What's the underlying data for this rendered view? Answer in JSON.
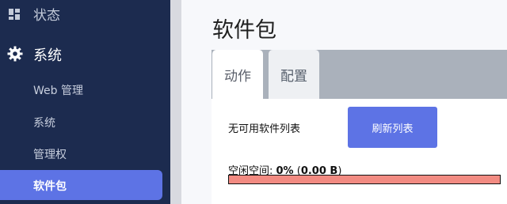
{
  "sidebar": {
    "status_label": "状态",
    "system_label": "系统",
    "items": [
      {
        "label": "Web 管理"
      },
      {
        "label": "系统"
      },
      {
        "label": "管理权"
      },
      {
        "label": "软件包"
      }
    ]
  },
  "main": {
    "title": "软件包",
    "tabs": [
      {
        "label": "动作"
      },
      {
        "label": "配置"
      }
    ],
    "no_packages_text": "无可用软件列表",
    "refresh_button": "刷新列表",
    "free_space_label": "空闲空间: ",
    "free_space_percent": "0%",
    "free_space_open": " (",
    "free_space_bytes": "0.00 B",
    "free_space_close": ")",
    "free_space_fraction": 0
  },
  "colors": {
    "sidebar_bg": "#1c2b4f",
    "accent": "#5d73e5",
    "progress_bg": "#f28b82"
  },
  "icons": {
    "status": "dashboard-icon",
    "system": "gear-icon"
  }
}
